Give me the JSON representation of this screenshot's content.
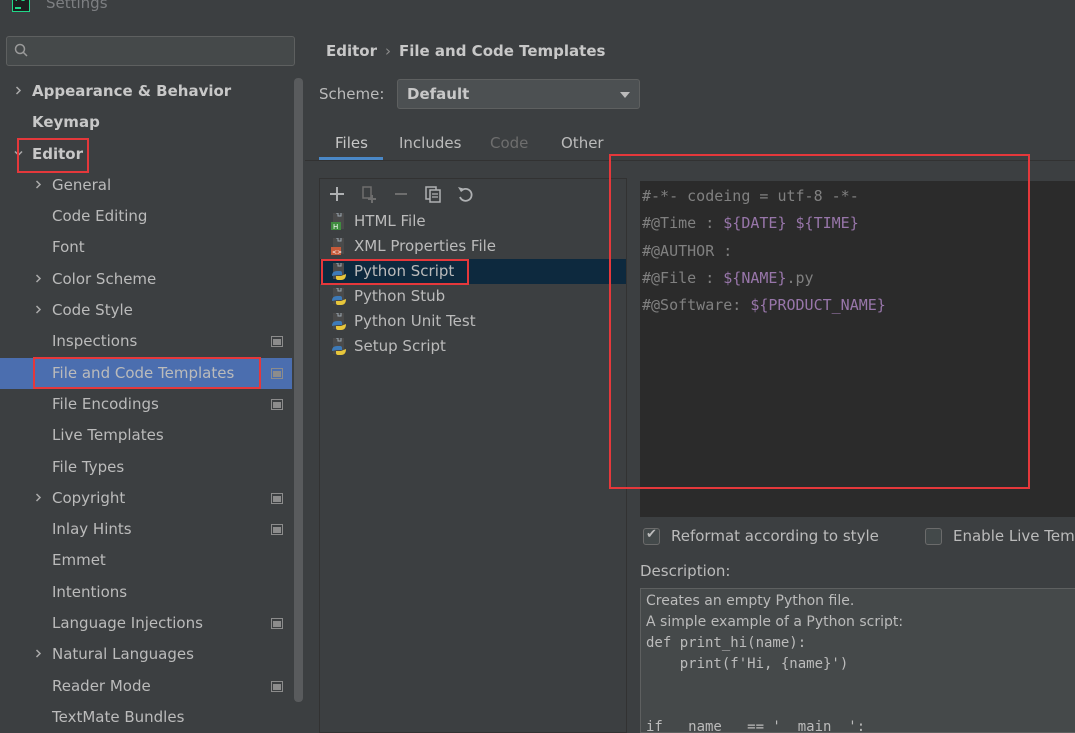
{
  "window": {
    "title": "Settings",
    "app_icon": "pycharm-logo-icon"
  },
  "search": {
    "placeholder": ""
  },
  "tree": [
    {
      "label": "Appearance & Behavior",
      "level": 0,
      "bold": true,
      "expandable": true,
      "expanded": false,
      "project_icon": false
    },
    {
      "label": "Keymap",
      "level": 0,
      "bold": true,
      "expandable": false,
      "project_icon": false
    },
    {
      "label": "Editor",
      "level": 0,
      "bold": true,
      "expandable": true,
      "expanded": true,
      "project_icon": false
    },
    {
      "label": "General",
      "level": 1,
      "expandable": true,
      "expanded": false,
      "project_icon": false
    },
    {
      "label": "Code Editing",
      "level": 1,
      "expandable": false,
      "project_icon": false
    },
    {
      "label": "Font",
      "level": 1,
      "expandable": false,
      "project_icon": false
    },
    {
      "label": "Color Scheme",
      "level": 1,
      "expandable": true,
      "expanded": false,
      "project_icon": false
    },
    {
      "label": "Code Style",
      "level": 1,
      "expandable": true,
      "expanded": false,
      "project_icon": false
    },
    {
      "label": "Inspections",
      "level": 1,
      "expandable": false,
      "project_icon": true
    },
    {
      "label": "File and Code Templates",
      "level": 1,
      "expandable": false,
      "project_icon": true,
      "selected": true
    },
    {
      "label": "File Encodings",
      "level": 1,
      "expandable": false,
      "project_icon": true
    },
    {
      "label": "Live Templates",
      "level": 1,
      "expandable": false,
      "project_icon": false
    },
    {
      "label": "File Types",
      "level": 1,
      "expandable": false,
      "project_icon": false
    },
    {
      "label": "Copyright",
      "level": 1,
      "expandable": true,
      "expanded": false,
      "project_icon": true
    },
    {
      "label": "Inlay Hints",
      "level": 1,
      "expandable": false,
      "project_icon": true
    },
    {
      "label": "Emmet",
      "level": 1,
      "expandable": false,
      "project_icon": false
    },
    {
      "label": "Intentions",
      "level": 1,
      "expandable": false,
      "project_icon": false
    },
    {
      "label": "Language Injections",
      "level": 1,
      "expandable": false,
      "project_icon": true
    },
    {
      "label": "Natural Languages",
      "level": 1,
      "expandable": true,
      "expanded": false,
      "project_icon": false
    },
    {
      "label": "Reader Mode",
      "level": 1,
      "expandable": false,
      "project_icon": true
    },
    {
      "label": "TextMate Bundles",
      "level": 1,
      "expandable": false,
      "project_icon": false
    }
  ],
  "breadcrumb": {
    "parent": "Editor",
    "separator": "›",
    "current": "File and Code Templates"
  },
  "scheme": {
    "label": "Scheme:",
    "value": "Default"
  },
  "tabs": [
    {
      "label": "Files",
      "active": true,
      "disabled": false
    },
    {
      "label": "Includes",
      "active": false,
      "disabled": false
    },
    {
      "label": "Code",
      "active": false,
      "disabled": true
    },
    {
      "label": "Other",
      "active": false,
      "disabled": false
    }
  ],
  "toolbar": [
    "add-icon",
    "copy-template-icon",
    "remove-icon",
    "duplicate-icon",
    "reset-icon"
  ],
  "templates": [
    {
      "label": "HTML File",
      "icon": "html-file-icon"
    },
    {
      "label": "XML Properties File",
      "icon": "xml-file-icon"
    },
    {
      "label": "Python Script",
      "icon": "python-file-icon",
      "selected": true
    },
    {
      "label": "Python Stub",
      "icon": "python-file-icon"
    },
    {
      "label": "Python Unit Test",
      "icon": "python-file-icon"
    },
    {
      "label": "Setup Script",
      "icon": "python-file-icon"
    }
  ],
  "editor": {
    "lines": [
      [
        {
          "t": "#-*- codeing = utf-8 -*-",
          "c": "comment"
        }
      ],
      [
        {
          "t": "#@Time : ",
          "c": "comment"
        },
        {
          "t": "${DATE}",
          "c": "var"
        },
        {
          "t": " ",
          "c": "comment"
        },
        {
          "t": "${TIME}",
          "c": "var"
        }
      ],
      [
        {
          "t": "#@AUTHOR :",
          "c": "comment"
        }
      ],
      [
        {
          "t": "#@File : ",
          "c": "comment"
        },
        {
          "t": "${NAME}",
          "c": "var"
        },
        {
          "t": ".py",
          "c": "comment"
        }
      ],
      [
        {
          "t": "#@Software: ",
          "c": "comment"
        },
        {
          "t": "${PRODUCT_NAME}",
          "c": "var"
        }
      ]
    ]
  },
  "reformat": {
    "label": "Reformat according to style",
    "checked": true
  },
  "live_templates": {
    "label": "Enable Live Temp",
    "checked": false
  },
  "description": {
    "label": "Description:",
    "lines": [
      {
        "t": "Creates an empty Python file.",
        "mono": false
      },
      {
        "t": "A simple example of a Python script:",
        "mono": false
      },
      {
        "t": "def print_hi(name):",
        "mono": true
      },
      {
        "t": "    print(f'Hi, {name}')",
        "mono": true
      },
      {
        "t": "",
        "mono": true
      },
      {
        "t": "",
        "mono": true
      },
      {
        "t": "if __name__ == '__main__':",
        "mono": true
      }
    ]
  },
  "colors": {
    "accent": "#4b6eaf",
    "annotation": "#e5383b",
    "editor_bg": "#2b2b2b",
    "code_var": "#9876aa",
    "code_comment": "#808080"
  }
}
